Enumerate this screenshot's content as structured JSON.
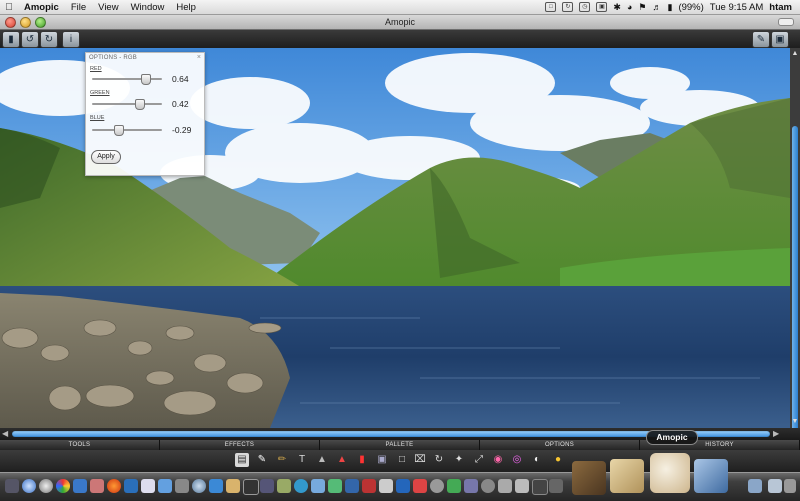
{
  "menubar": {
    "app": "Amopic",
    "items": [
      "File",
      "View",
      "Window",
      "Help"
    ],
    "battery": "(99%)",
    "clock": "Tue 9:15 AM",
    "user": "htam"
  },
  "window": {
    "title": "Amopic"
  },
  "options_panel": {
    "title": "OPTIONS - RGB",
    "sliders": [
      {
        "label": "RED",
        "value": "0.64",
        "level": 0.82
      },
      {
        "label": "GREEN",
        "value": "0.42",
        "level": 0.71
      },
      {
        "label": "BLUE",
        "value": "-0.29",
        "level": 0.36
      }
    ],
    "apply_label": "Apply"
  },
  "tabs": [
    "TOOLS",
    "EFFECTS",
    "PALLETE",
    "OPTIONS",
    "HISTORY"
  ],
  "dock_tooltip": "Amopic",
  "colors": {
    "accent_blue": "#3d8fdc",
    "toolbar_dark": "#1e1e1e",
    "menubar_light": "#e6e6e6"
  },
  "icons": {
    "toolbar": [
      "library-icon",
      "rotate-left-icon",
      "rotate-right-icon",
      "info-icon",
      "share-icon",
      "save-icon"
    ]
  }
}
